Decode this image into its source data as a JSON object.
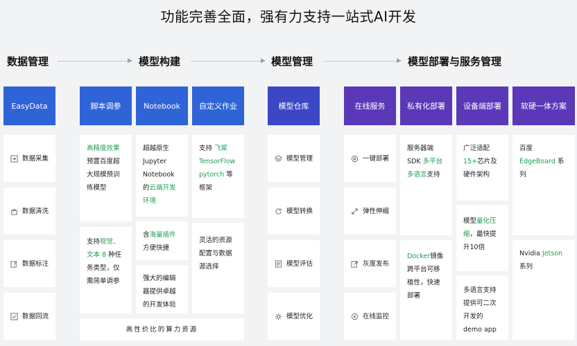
{
  "title": "功能完善全面，强有力支持一站式AI开发",
  "sections": {
    "s1": "数据管理",
    "s2": "模型构建",
    "s3": "模型管理",
    "s4": "模型部署与服务管理"
  },
  "headers": {
    "easydata": "EasyData",
    "script": "脚本调参",
    "notebook": "Notebook",
    "custom": "自定义作业",
    "repo": "模型仓库",
    "online": "在线服务",
    "private": "私有化部署",
    "device": "设备端部署",
    "hardware": "软硬一体方案"
  },
  "data_items": [
    "数据采集",
    "数据清洗",
    "数据标注",
    "数据回流"
  ],
  "model_items": [
    "模型管理",
    "模型转换",
    "模型评估",
    "模型优化"
  ],
  "service_items": [
    "一键部署",
    "弹性伸缩",
    "灰度发布",
    "在线监控"
  ],
  "script": {
    "c1": {
      "hl": "高精度效果",
      "rest": "预置百度超大规模预训练模型"
    },
    "c2": {
      "a": "支持",
      "hl": "视觉、文本 8",
      "rest": " 种任务类型，仅需简单调参"
    }
  },
  "notebook": {
    "c1": {
      "a": "超越原生 Jupyter Notebook 的",
      "hl": "云端开发环境"
    },
    "c2": {
      "a": "含",
      "hl": "海量插件",
      "rest": "方便快捷"
    },
    "c3": "强大的编辑器提供卓越的开发体验"
  },
  "custom": {
    "c1": {
      "a": "支持 ",
      "hl": "飞桨 TensorFlow pytorch",
      "rest": " 等框架"
    },
    "c2": "灵活的资源配置与数据源选择"
  },
  "compute": "高性价比的算力资源",
  "private": {
    "c1": {
      "a": "服务器端SDK ",
      "hl": "多平台多语言",
      "rest": "支持"
    },
    "c2": {
      "hl": "Docker",
      "rest": "镜像跨平台可移植性，快速部署"
    }
  },
  "device": {
    "c1": {
      "a": "广泛适配",
      "hl": "15+",
      "rest": "芯片及硬件架构"
    },
    "c2": {
      "a": "模型",
      "hl": "量化压缩",
      "rest": "，最快提升10倍"
    },
    "c3": "多语言支持提供可二次开发的demo app"
  },
  "hardware": {
    "c1": {
      "a": "百度",
      "hl": "EdgeBoard",
      "rest": " 系列"
    },
    "c2": {
      "a": "Nvidia ",
      "hl": "Jetson",
      "rest": " 系列"
    }
  },
  "colors": {
    "blue": "#2f63d8",
    "indigo": "#3b47c4",
    "purple": "#5a38b8",
    "highlight": "#1f9d55",
    "bg": "#f2f3f5"
  }
}
